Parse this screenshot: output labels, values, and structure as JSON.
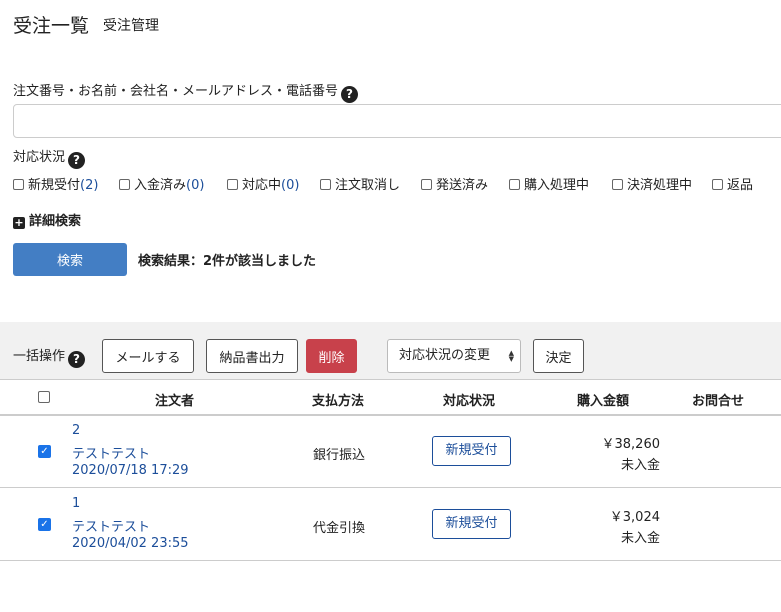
{
  "header": {
    "title": "受注一覧",
    "subtitle": "受注管理"
  },
  "search": {
    "keyword_label": "注文番号・お名前・会社名・メールアドレス・電話番号",
    "keyword_value": "",
    "status_label": "対応状況",
    "statuses": [
      {
        "label": "新規受付",
        "count": "(2)"
      },
      {
        "label": "入金済み",
        "count": "(0)"
      },
      {
        "label": "対応中",
        "count": "(0)"
      },
      {
        "label": "注文取消し",
        "count": ""
      },
      {
        "label": "発送済み",
        "count": ""
      },
      {
        "label": "購入処理中",
        "count": ""
      },
      {
        "label": "決済処理中",
        "count": ""
      },
      {
        "label": "返品",
        "count": ""
      }
    ],
    "detail_search_label": "詳細検索",
    "search_button": "検索",
    "result_text": "検索結果：2件が該当しました"
  },
  "bulk": {
    "label": "一括操作",
    "mail_button": "メールする",
    "delivery_button": "納品書出力",
    "delete_button": "削除",
    "status_select": "対応状況の変更",
    "decide_button": "決定"
  },
  "table": {
    "headers": {
      "orderer": "注文者",
      "payment": "支払方法",
      "status": "対応状況",
      "amount": "購入金額",
      "inquiry": "お問合せ"
    },
    "rows": [
      {
        "order_no": "2",
        "orderer": "テストテスト",
        "date": "2020/07/18 17:29",
        "payment": "銀行振込",
        "status": "新規受付",
        "amount": "￥38,260",
        "pay_state": "未入金",
        "checked": true
      },
      {
        "order_no": "1",
        "orderer": "テストテスト",
        "date": "2020/04/02 23:55",
        "payment": "代金引換",
        "status": "新規受付",
        "amount": "￥3,024",
        "pay_state": "未入金",
        "checked": true
      }
    ]
  },
  "colors": {
    "primary": "#437ec4",
    "danger": "#c8414b",
    "link": "#1c4e9a",
    "checkbox": "#1a73e8"
  }
}
